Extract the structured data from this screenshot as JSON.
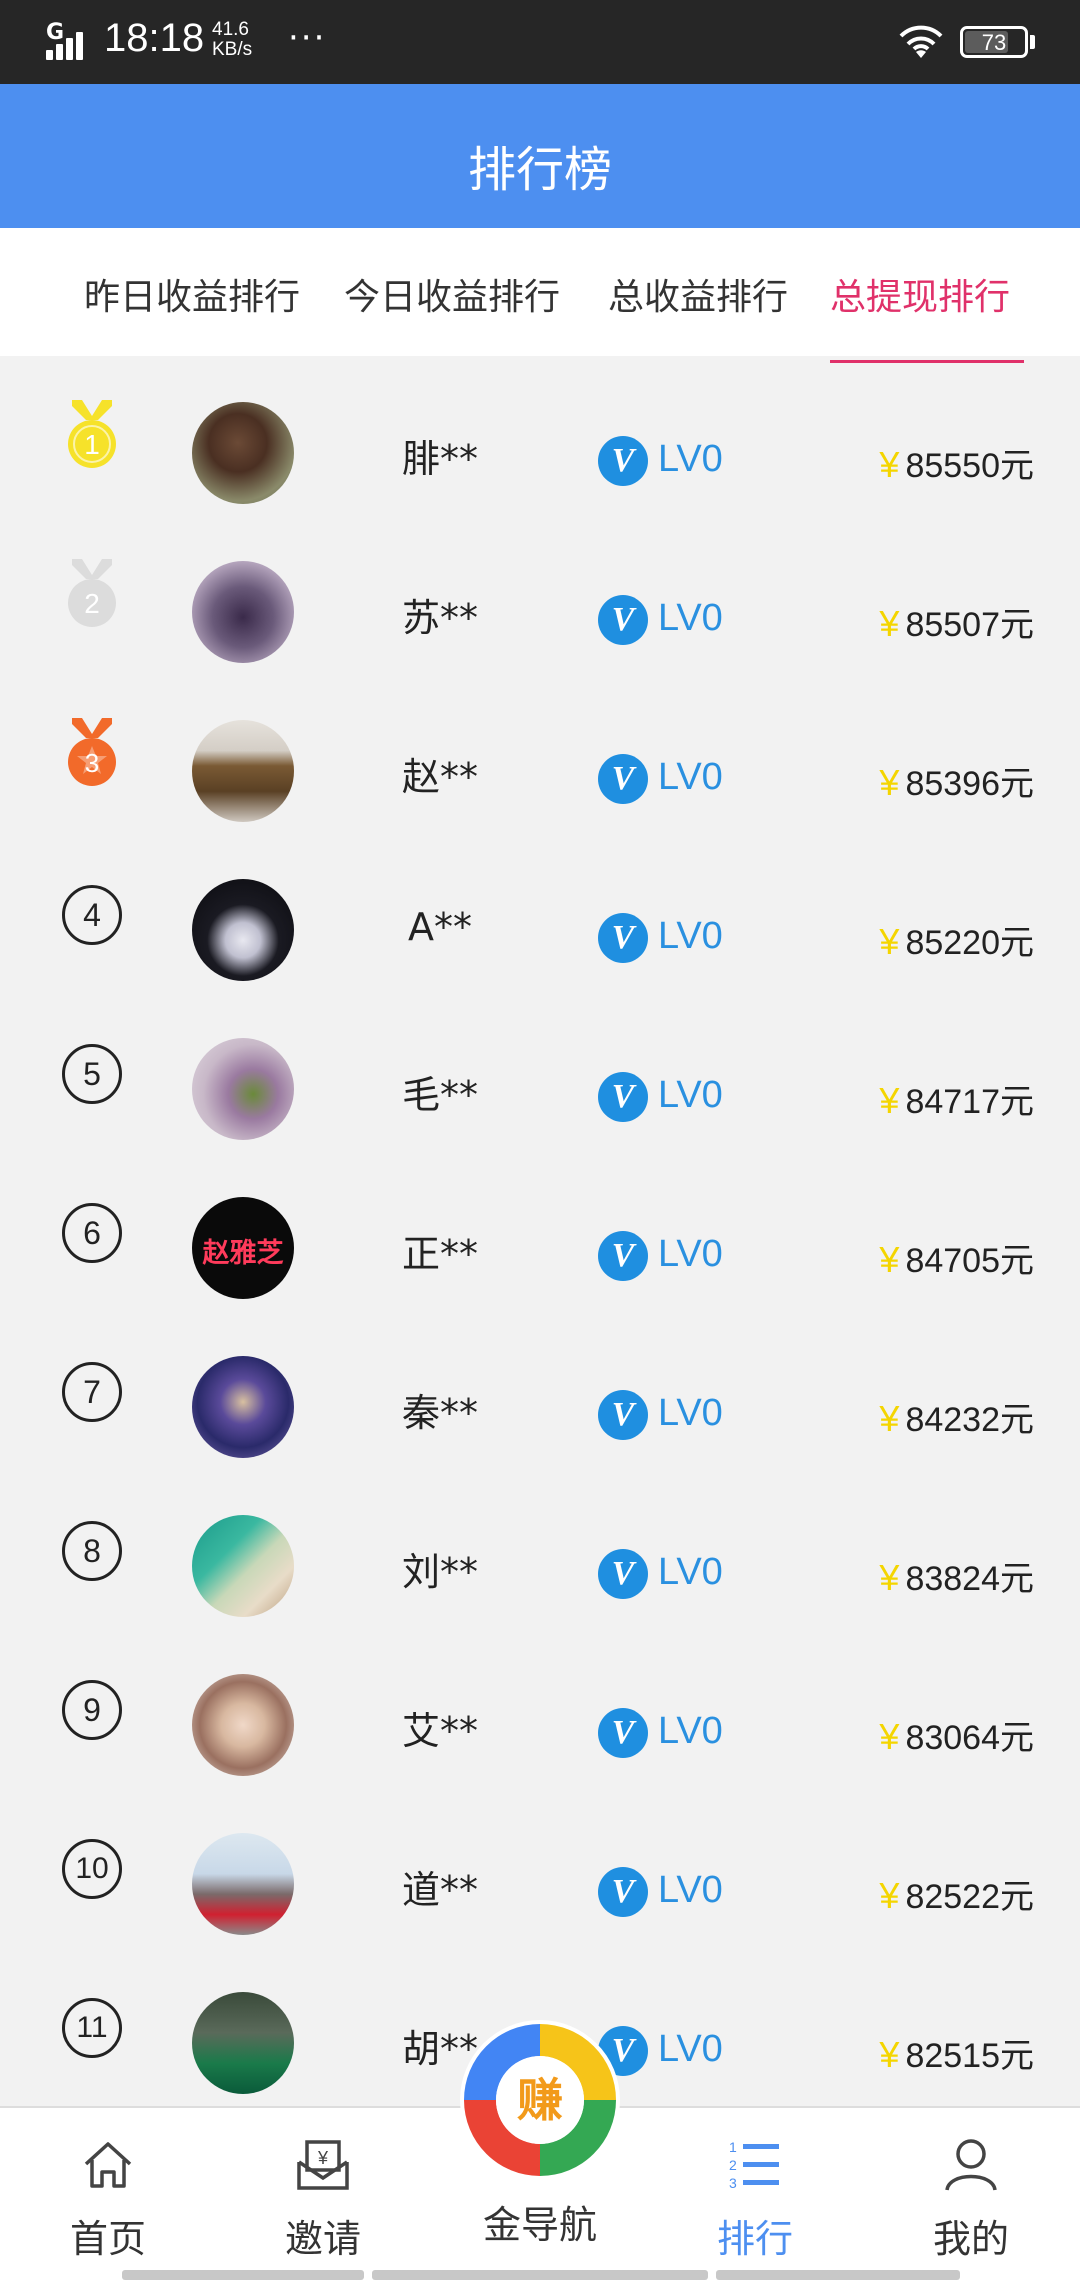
{
  "status_bar": {
    "network": "G",
    "time": "18:18",
    "speed_value": "41.6",
    "speed_unit": "KB/s",
    "more": "···",
    "battery": "73"
  },
  "header": {
    "title": "排行榜"
  },
  "tabs": [
    {
      "label": "昨日收益排行"
    },
    {
      "label": "今日收益排行"
    },
    {
      "label": "总收益排行"
    },
    {
      "label": "总提现排行",
      "active": true
    }
  ],
  "ranking": [
    {
      "rank": "1",
      "name": "腓**",
      "level": "LV0",
      "amount": "85550元",
      "yen": "¥"
    },
    {
      "rank": "2",
      "name": "苏**",
      "level": "LV0",
      "amount": "85507元",
      "yen": "¥"
    },
    {
      "rank": "3",
      "name": "赵**",
      "level": "LV0",
      "amount": "85396元",
      "yen": "¥"
    },
    {
      "rank": "4",
      "name": "A**",
      "level": "LV0",
      "amount": "85220元",
      "yen": "¥"
    },
    {
      "rank": "5",
      "name": "毛**",
      "level": "LV0",
      "amount": "84717元",
      "yen": "¥"
    },
    {
      "rank": "6",
      "name": "正**",
      "level": "LV0",
      "amount": "84705元",
      "yen": "¥",
      "avatar_text": "赵雅芝"
    },
    {
      "rank": "7",
      "name": "秦**",
      "level": "LV0",
      "amount": "84232元",
      "yen": "¥"
    },
    {
      "rank": "8",
      "name": "刘**",
      "level": "LV0",
      "amount": "83824元",
      "yen": "¥"
    },
    {
      "rank": "9",
      "name": "艾**",
      "level": "LV0",
      "amount": "83064元",
      "yen": "¥"
    },
    {
      "rank": "10",
      "name": "道**",
      "level": "LV0",
      "amount": "82522元",
      "yen": "¥"
    },
    {
      "rank": "11",
      "name": "胡**",
      "level": "LV0",
      "amount": "82515元",
      "yen": "¥"
    }
  ],
  "bottom_nav": {
    "home": "首页",
    "invite": "邀请",
    "center": "金导航",
    "center_badge": "赚",
    "rank": "排行",
    "mine": "我的"
  },
  "icons": {
    "status": [
      "signal-icon",
      "wifi-icon",
      "battery-icon"
    ],
    "nav": [
      "home-icon",
      "invite-icon",
      "earn-icon",
      "rank-icon",
      "profile-icon"
    ],
    "medals": [
      "gold-medal-icon",
      "silver-medal-icon",
      "bronze-medal-icon"
    ],
    "verified": "verified-v-icon"
  },
  "colors": {
    "header_bg": "#4d8ff0",
    "active_tab": "#e0316a",
    "level_text": "#2a90e0",
    "yen": "#f4d500",
    "nav_active": "#4d8ff0"
  }
}
